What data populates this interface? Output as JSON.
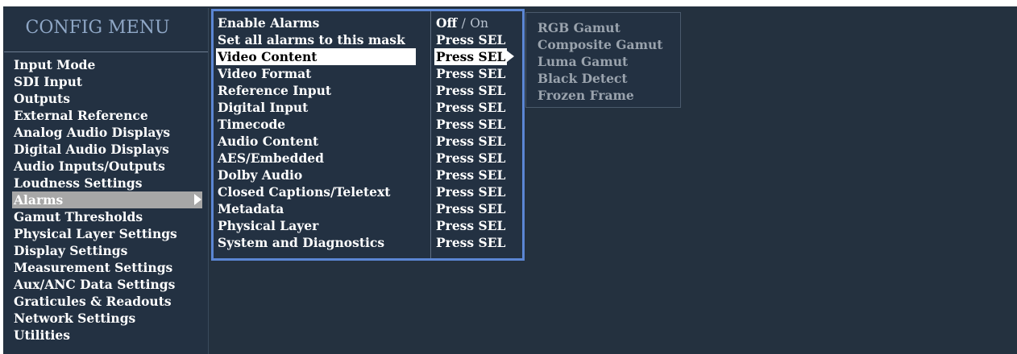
{
  "config_menu": {
    "title": "CONFIG MENU",
    "items": [
      {
        "label": "Input Mode"
      },
      {
        "label": "SDI Input"
      },
      {
        "label": "Outputs"
      },
      {
        "label": "External Reference"
      },
      {
        "label": "Analog Audio Displays"
      },
      {
        "label": "Digital Audio Displays"
      },
      {
        "label": "Audio Inputs/Outputs"
      },
      {
        "label": "Loudness Settings"
      },
      {
        "label": "Alarms",
        "selected": true
      },
      {
        "label": "Gamut Thresholds"
      },
      {
        "label": "Physical Layer Settings"
      },
      {
        "label": "Display Settings"
      },
      {
        "label": "Measurement Settings"
      },
      {
        "label": "Aux/ANC Data Settings"
      },
      {
        "label": "Graticules & Readouts"
      },
      {
        "label": "Network Settings"
      },
      {
        "label": "Utilities"
      }
    ]
  },
  "alarms_menu": {
    "enable": {
      "label": "Enable Alarms",
      "off": "Off",
      "sep": "/",
      "on": "On"
    },
    "rows": [
      {
        "label": "Set all alarms to this mask",
        "value": "Press SEL"
      },
      {
        "label": "Video Content",
        "value": "Press SEL",
        "selected": true
      },
      {
        "label": "Video Format",
        "value": "Press SEL"
      },
      {
        "label": "Reference Input",
        "value": "Press SEL"
      },
      {
        "label": "Digital Input",
        "value": "Press SEL"
      },
      {
        "label": "Timecode",
        "value": "Press SEL"
      },
      {
        "label": "Audio Content",
        "value": "Press SEL"
      },
      {
        "label": "AES/Embedded",
        "value": "Press SEL"
      },
      {
        "label": "Dolby Audio",
        "value": "Press SEL"
      },
      {
        "label": "Closed Captions/Teletext",
        "value": "Press SEL"
      },
      {
        "label": "Metadata",
        "value": "Press SEL"
      },
      {
        "label": "Physical Layer",
        "value": "Press SEL"
      },
      {
        "label": "System and Diagnostics",
        "value": "Press SEL"
      }
    ]
  },
  "video_content_menu": {
    "items": [
      {
        "label": "RGB Gamut"
      },
      {
        "label": "Composite Gamut"
      },
      {
        "label": "Luma Gamut"
      },
      {
        "label": "Black Detect"
      },
      {
        "label": "Frozen Frame"
      }
    ]
  },
  "colors": {
    "background": "#24313f",
    "title": "#8fa7c6",
    "highlight_box": "#5b86d4",
    "selected_gray": "#a7a7a7",
    "disabled_text": "#9aa3ad"
  }
}
